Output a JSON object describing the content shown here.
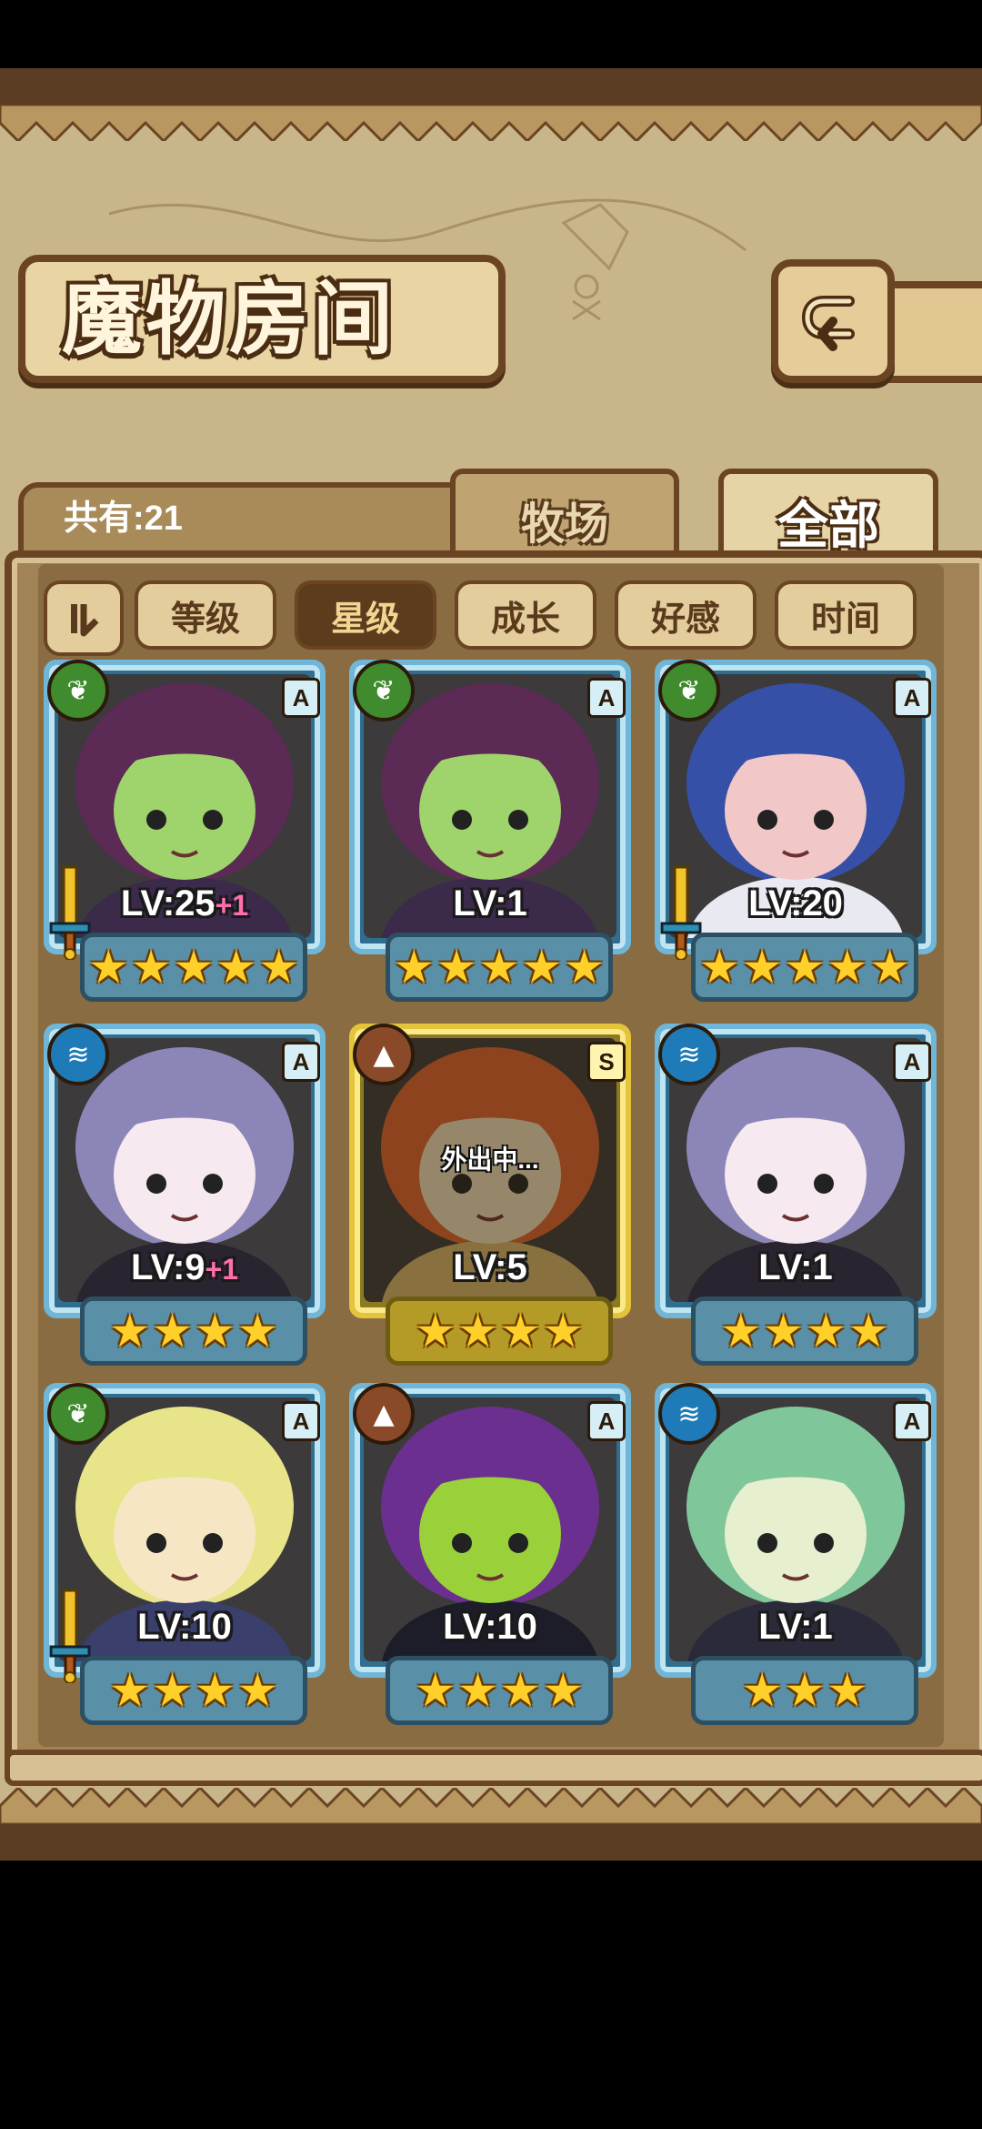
{
  "header": {
    "title": "魔物房间",
    "back_icon": "return-arrow-icon"
  },
  "summary": {
    "count_label": "共有:21"
  },
  "tabs": [
    {
      "label": "牧场",
      "active": false
    },
    {
      "label": "全部",
      "active": true
    }
  ],
  "sort": {
    "toggle_icon": "sort-order-icon",
    "buttons": [
      {
        "label": "等级",
        "active": false
      },
      {
        "label": "星级",
        "active": true
      },
      {
        "label": "成长",
        "active": false
      },
      {
        "label": "好感",
        "active": false
      },
      {
        "label": "时间",
        "active": false
      }
    ]
  },
  "monsters": [
    {
      "element": "leaf",
      "rank": "A",
      "level": "LV:25",
      "bonus": "+1",
      "stars": 5,
      "weapon": true,
      "frame": "blue",
      "status": "",
      "colors": [
        "#5b2a55",
        "#3b2a4a",
        "#9fd36b"
      ]
    },
    {
      "element": "leaf",
      "rank": "A",
      "level": "LV:1",
      "bonus": "",
      "stars": 5,
      "weapon": false,
      "frame": "blue",
      "status": "",
      "colors": [
        "#5b2a55",
        "#3b2a4a",
        "#9fd36b"
      ]
    },
    {
      "element": "leaf",
      "rank": "A",
      "level": "LV:20",
      "bonus": "",
      "stars": 5,
      "weapon": true,
      "frame": "blue",
      "status": "",
      "colors": [
        "#3650a8",
        "#e9e9f2",
        "#f2c7c7"
      ]
    },
    {
      "element": "water",
      "rank": "A",
      "level": "LV:9",
      "bonus": "+1",
      "stars": 4,
      "weapon": false,
      "frame": "blue",
      "status": "",
      "colors": [
        "#8c86b8",
        "#2a2430",
        "#f6e9ef"
      ]
    },
    {
      "element": "rock",
      "rank": "S",
      "level": "LV:5",
      "bonus": "",
      "stars": 4,
      "weapon": false,
      "frame": "gold",
      "status": "外出中...",
      "colors": [
        "#e0622f",
        "#d7b56a",
        "#f3dcb8"
      ]
    },
    {
      "element": "water",
      "rank": "A",
      "level": "LV:1",
      "bonus": "",
      "stars": 4,
      "weapon": false,
      "frame": "blue",
      "status": "",
      "colors": [
        "#8c86b8",
        "#2a2430",
        "#f6e9ef"
      ]
    },
    {
      "element": "leaf",
      "rank": "A",
      "level": "LV:10",
      "bonus": "",
      "stars": 4,
      "weapon": true,
      "frame": "blue",
      "status": "",
      "colors": [
        "#e7e48a",
        "#3b3f6b",
        "#f7e6c4"
      ]
    },
    {
      "element": "rock",
      "rank": "A",
      "level": "LV:10",
      "bonus": "",
      "stars": 4,
      "weapon": false,
      "frame": "blue",
      "status": "",
      "colors": [
        "#6b2f8f",
        "#1d1d2a",
        "#9ad13a"
      ]
    },
    {
      "element": "water",
      "rank": "A",
      "level": "LV:1",
      "bonus": "",
      "stars": 3,
      "weapon": false,
      "frame": "blue",
      "status": "",
      "colors": [
        "#7fc79a",
        "#2a2a3a",
        "#e6f0cf"
      ]
    }
  ]
}
